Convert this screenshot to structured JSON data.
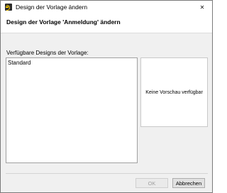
{
  "window": {
    "title": "Design der Vorlage ändern",
    "close_glyph": "✕"
  },
  "header": {
    "title": "Design der Vorlage 'Anmeldung' ändern"
  },
  "designs": {
    "label": "Verfügbare Designs der Vorlage:",
    "items": [
      "Standard"
    ]
  },
  "preview": {
    "empty_text": "Keine Vorschau verfügbar"
  },
  "buttons": {
    "ok_label": "OK",
    "ok_enabled": false,
    "cancel_label": "Abbrechen"
  },
  "icons": {
    "app": "app-logo-icon",
    "close": "close-icon"
  }
}
